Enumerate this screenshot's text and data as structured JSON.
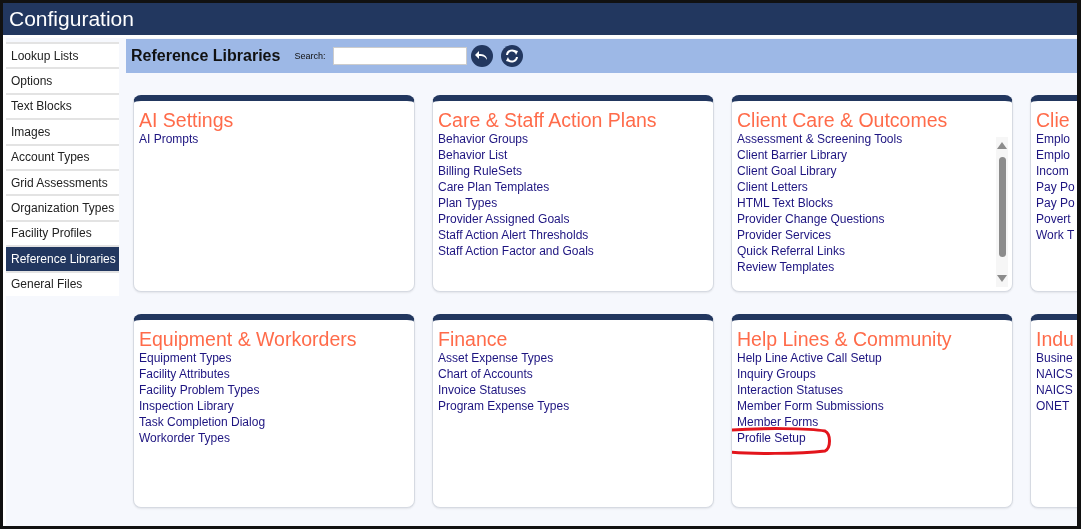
{
  "window": {
    "title": "Configuration"
  },
  "sidebar": {
    "items": [
      {
        "label": "Lookup Lists",
        "selected": false
      },
      {
        "label": "Options",
        "selected": false
      },
      {
        "label": "Text Blocks",
        "selected": false
      },
      {
        "label": "Images",
        "selected": false
      },
      {
        "label": "Account Types",
        "selected": false
      },
      {
        "label": "Grid Assessments",
        "selected": false
      },
      {
        "label": "Organization Types",
        "selected": false
      },
      {
        "label": "Facility Profiles",
        "selected": false
      },
      {
        "label": "Reference Libraries",
        "selected": true
      },
      {
        "label": "General Files",
        "selected": false
      }
    ]
  },
  "header": {
    "title": "Reference Libraries",
    "search_label": "Search:"
  },
  "cards": [
    {
      "title": "AI Settings",
      "scrollable": false,
      "items": [
        {
          "label": "AI Prompts",
          "circled": false
        }
      ]
    },
    {
      "title": "Care & Staff Action Plans",
      "scrollable": false,
      "items": [
        {
          "label": "Behavior Groups",
          "circled": false
        },
        {
          "label": "Behavior List",
          "circled": false
        },
        {
          "label": "Billing RuleSets",
          "circled": false
        },
        {
          "label": "Care Plan Templates",
          "circled": false
        },
        {
          "label": "Plan Types",
          "circled": false
        },
        {
          "label": "Provider Assigned Goals",
          "circled": false
        },
        {
          "label": "Staff Action Alert Thresholds",
          "circled": false
        },
        {
          "label": "Staff Action Factor and Goals",
          "circled": false
        }
      ]
    },
    {
      "title": "Client Care & Outcomes",
      "scrollable": true,
      "items": [
        {
          "label": "Assessment & Screening Tools",
          "circled": false
        },
        {
          "label": "Client Barrier Library",
          "circled": false
        },
        {
          "label": "Client Goal Library",
          "circled": false
        },
        {
          "label": "Client Letters",
          "circled": false
        },
        {
          "label": "HTML Text Blocks",
          "circled": false
        },
        {
          "label": "Provider Change Questions",
          "circled": false
        },
        {
          "label": "Provider Services",
          "circled": false
        },
        {
          "label": "Quick Referral Links",
          "circled": false
        },
        {
          "label": "Review Templates",
          "circled": false
        }
      ]
    },
    {
      "title": "Clie",
      "scrollable": false,
      "items": [
        {
          "label": "Emplo",
          "circled": false
        },
        {
          "label": "Emplo",
          "circled": false
        },
        {
          "label": "Incom",
          "circled": false
        },
        {
          "label": "Pay Po",
          "circled": false
        },
        {
          "label": "Pay Po",
          "circled": false
        },
        {
          "label": "Povert",
          "circled": false
        },
        {
          "label": "Work T",
          "circled": false
        }
      ]
    },
    {
      "title": "Equipment & Workorders",
      "scrollable": false,
      "items": [
        {
          "label": "Equipment Types",
          "circled": false
        },
        {
          "label": "Facility Attributes",
          "circled": false
        },
        {
          "label": "Facility Problem Types",
          "circled": false
        },
        {
          "label": "Inspection Library",
          "circled": false
        },
        {
          "label": "Task Completion Dialog",
          "circled": false
        },
        {
          "label": "Workorder Types",
          "circled": false
        }
      ]
    },
    {
      "title": "Finance",
      "scrollable": false,
      "items": [
        {
          "label": "Asset Expense Types",
          "circled": false
        },
        {
          "label": "Chart of Accounts",
          "circled": false
        },
        {
          "label": "Invoice Statuses",
          "circled": false
        },
        {
          "label": "Program Expense Types",
          "circled": false
        }
      ]
    },
    {
      "title": "Help Lines & Community",
      "scrollable": false,
      "items": [
        {
          "label": "Help Line Active Call Setup",
          "circled": false
        },
        {
          "label": "Inquiry Groups",
          "circled": false
        },
        {
          "label": "Interaction Statuses",
          "circled": false
        },
        {
          "label": "Member Form Submissions",
          "circled": false
        },
        {
          "label": "Member Forms",
          "circled": false
        },
        {
          "label": "Profile Setup",
          "circled": true
        }
      ]
    },
    {
      "title": "Indu",
      "scrollable": false,
      "items": [
        {
          "label": "Busine",
          "circled": false
        },
        {
          "label": "NAICS",
          "circled": false
        },
        {
          "label": "NAICS",
          "circled": false
        },
        {
          "label": "ONET",
          "circled": false
        }
      ]
    }
  ]
}
